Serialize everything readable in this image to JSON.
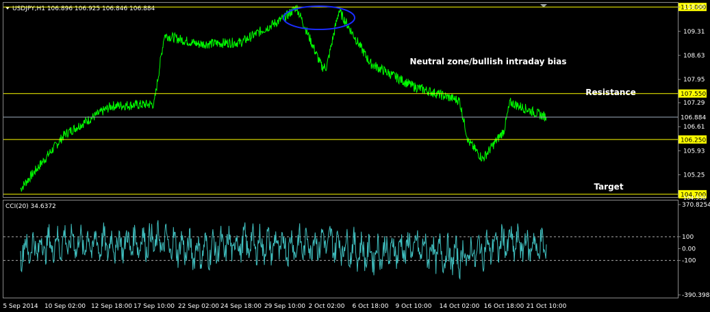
{
  "chart_data": [
    {
      "type": "line",
      "title": "USDJPY,H1  106.896 106.925 106.846 106.884",
      "symbol": "USDJPY",
      "timeframe": "H1",
      "ohlc": {
        "open": 106.896,
        "high": 106.925,
        "low": 106.846,
        "close": 106.884
      },
      "x_ticks": [
        "5 Sep 2014",
        "10 Sep 02:00",
        "12 Sep 18:00",
        "17 Sep 10:00",
        "22 Sep 02:00",
        "24 Sep 18:00",
        "29 Sep 10:00",
        "2 Oct 02:00",
        "6 Oct 18:00",
        "9 Oct 10:00",
        "14 Oct 02:00",
        "16 Oct 18:00",
        "21 Oct 10:00"
      ],
      "y_ticks": [
        110.0,
        109.31,
        108.63,
        107.95,
        107.29,
        106.61,
        105.93,
        105.25
      ],
      "ylim": [
        104.62,
        110.12
      ],
      "series": [
        {
          "color": "#00ff00",
          "x": [
            "5 Sep 2014",
            "10 Sep 02:00",
            "12 Sep 18:00",
            "17 Sep 10:00",
            "19 Sep",
            "22 Sep 02:00",
            "24 Sep 18:00",
            "29 Sep 10:00",
            "30 Sep",
            "1 Oct",
            "2 Oct 02:00",
            "3 Oct",
            "6 Oct 18:00",
            "9 Oct 10:00",
            "14 Oct 02:00",
            "14 Oct",
            "15 Oct",
            "16 Oct 18:00",
            "20 Oct",
            "21 Oct 10:00"
          ],
          "values": [
            104.85,
            106.4,
            107.2,
            107.25,
            109.2,
            108.95,
            109.0,
            109.7,
            110.0,
            108.3,
            108.3,
            109.9,
            108.4,
            107.75,
            107.35,
            106.2,
            105.7,
            106.5,
            107.3,
            106.88
          ]
        }
      ],
      "hlines": [
        {
          "value": 110.0,
          "label": "110.000",
          "color": "#ffff00"
        },
        {
          "value": 107.55,
          "label": "107.550",
          "color": "#ffff00",
          "annotation": "Resistance"
        },
        {
          "value": 106.884,
          "label": "106.884",
          "color": "#a0b0c0",
          "current": true
        },
        {
          "value": 106.25,
          "label": "106.250",
          "color": "#ffff00"
        },
        {
          "value": 104.7,
          "label": "104.700",
          "color": "#ffff00",
          "annotation": "Target"
        }
      ],
      "annotations": [
        "Neutral zone/bullish intraday bias",
        "Resistance",
        "Target"
      ],
      "bottom_partial_tick": "104.550"
    },
    {
      "type": "line",
      "title": "CCI(20) 34.6372",
      "indicator": "CCI",
      "period": 20,
      "last_value": 34.6372,
      "y_ticks_labels": [
        "370.8254",
        "100",
        "0.00",
        "-100",
        "-390.3988"
      ],
      "ylim": [
        -390.3988,
        370.8254
      ],
      "levels": [
        100,
        -100
      ],
      "series": [
        {
          "color": "#40c0c0",
          "x": [
            "5 Sep 2014",
            "10 Sep 02:00",
            "12 Sep 18:00",
            "17 Sep 10:00",
            "22 Sep 02:00",
            "24 Sep 18:00",
            "29 Sep 10:00",
            "2 Oct 02:00",
            "6 Oct 18:00",
            "9 Oct 10:00",
            "14 Oct 02:00",
            "16 Oct 18:00",
            "21 Oct 10:00"
          ],
          "values": [
            -40,
            180,
            110,
            220,
            -80,
            150,
            60,
            200,
            -150,
            40,
            -260,
            170,
            35
          ]
        }
      ]
    }
  ]
}
